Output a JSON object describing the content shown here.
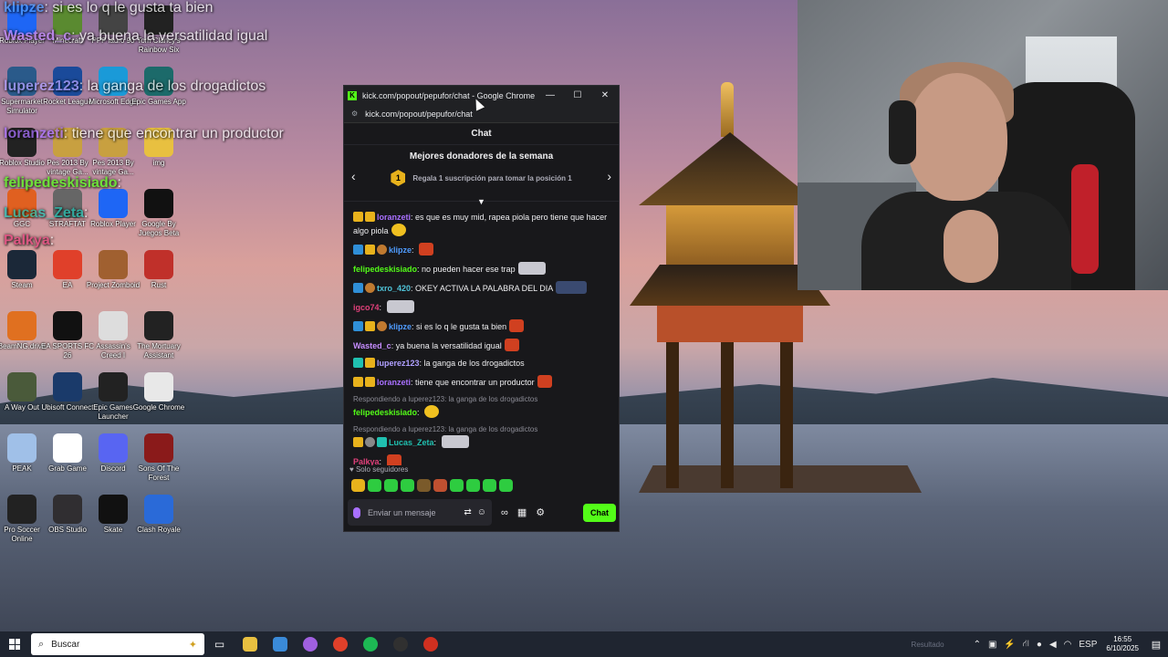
{
  "window": {
    "title": "kick.com/popout/pepufor/chat - Google Chrome",
    "url": "kick.com/popout/pepufor/chat",
    "minimize": "—",
    "maximize": "☐",
    "close": "✕"
  },
  "chat": {
    "header": "Chat",
    "donors_title": "Mejores donadores de la semana",
    "donors_badge": "1",
    "donors_text": "Regala 1 suscripción para tomar la posición 1",
    "prev": "‹",
    "next": "›",
    "messages": [
      {
        "user": "loranzeti",
        "color": "#a970ff",
        "text": "es que es muy mid, rapea piola pero tiene que hacer algo piola"
      },
      {
        "user": "klipze",
        "color": "#4f9cff",
        "text": ""
      },
      {
        "user": "felipedeskisiado",
        "color": "#53fc18",
        "text": "no pueden hacer ese trap"
      },
      {
        "user": "txro_420",
        "color": "#4fc3d8",
        "text": "OKEY ACTIVA LA PALABRA DEL DIA"
      },
      {
        "user": "igco74",
        "color": "#e0407a",
        "text": ""
      },
      {
        "user": "klipze",
        "color": "#4f9cff",
        "text": "si es lo q le gusta ta bien"
      },
      {
        "user": "Wasted_c",
        "color": "#c58cff",
        "text": "ya buena la versatilidad igual"
      },
      {
        "user": "luperez123",
        "color": "#b0a0ff",
        "text": "la ganga de los drogadictos"
      },
      {
        "user": "loranzeti",
        "color": "#a970ff",
        "text": "tiene que encontrar un productor"
      },
      {
        "reply": "Respondiendo a luperez123: la ganga de los drogadictos",
        "user": "felipedeskisiado",
        "color": "#53fc18",
        "text": ""
      },
      {
        "reply": "Respondiendo a luperez123: la ganga de los drogadictos",
        "user": "Lucas_Zeta",
        "color": "#20c0b0",
        "text": ""
      },
      {
        "user": "Palkya",
        "color": "#e0407a",
        "text": ""
      }
    ],
    "followers_only": "♥ Solo seguidores",
    "input_placeholder": "Enviar un mensaje",
    "send_label": "Chat"
  },
  "overlay_lines": [
    {
      "user": "klipze",
      "text": "si es lo q le gusta ta bien"
    },
    {
      "user": "Wasted_c",
      "text": "ya buena la versatilidad igual"
    },
    {
      "user": "luperez123",
      "text": "la ganga de los drogadictos"
    },
    {
      "user": "loranzeti",
      "text": "tiene que encontrar un productor"
    },
    {
      "user": "felipedeskisiado",
      "text": ""
    },
    {
      "user": "Lucas_Zeta",
      "text": ""
    },
    {
      "user": "Palkya",
      "text": ""
    }
  ],
  "desktop_icons": [
    {
      "label": "Roblox Player",
      "color": "#1e66f5"
    },
    {
      "label": "Minecraft",
      "color": "#5a8a30"
    },
    {
      "label": "PPP lauro 90",
      "color": "#444444"
    },
    {
      "label": "Tom Clancy's Rainbow Six",
      "color": "#222222"
    },
    {
      "label": "Supermarket Simulator",
      "color": "#2a5a8a"
    },
    {
      "label": "Rocket League",
      "color": "#1a4a9a"
    },
    {
      "label": "Microsoft Edge",
      "color": "#1a9ad8"
    },
    {
      "label": "Epic Games App",
      "color": "#1c6a6a"
    },
    {
      "label": "Roblox Studio",
      "color": "#222222"
    },
    {
      "label": "Pes 2013 By vintage Ga...",
      "color": "#c8a040"
    },
    {
      "label": "Pes 2013 By vintage Ga...",
      "color": "#c8a040"
    },
    {
      "label": "img",
      "color": "#e8c040"
    },
    {
      "label": "GGC",
      "color": "#e06020"
    },
    {
      "label": "STRAFTAT",
      "color": "#666666"
    },
    {
      "label": "Roblox Player",
      "color": "#1e66f5"
    },
    {
      "label": "Google By Juegos Beta",
      "color": "#111111"
    },
    {
      "label": "Steam",
      "color": "#1b2838"
    },
    {
      "label": "EA",
      "color": "#e0402a"
    },
    {
      "label": "Project Zomboid",
      "color": "#a06030"
    },
    {
      "label": "Rust",
      "color": "#c0302a"
    },
    {
      "label": "BeamNG.drive",
      "color": "#e07020"
    },
    {
      "label": "EA SPORTS FC 26",
      "color": "#111111"
    },
    {
      "label": "Assassin's Creed I",
      "color": "#dddddd"
    },
    {
      "label": "The Mortuary Assistant",
      "color": "#222222"
    },
    {
      "label": "A Way Out",
      "color": "#4a5a3a"
    },
    {
      "label": "Ubisoft Connect",
      "color": "#1a3a6a"
    },
    {
      "label": "Epic Games Launcher",
      "color": "#222222"
    },
    {
      "label": "Google Chrome",
      "color": "#e8e8e8"
    },
    {
      "label": "PEAK",
      "color": "#a0c0e8"
    },
    {
      "label": "Grab Game",
      "color": "#ffffff"
    },
    {
      "label": "Discord",
      "color": "#5865f2"
    },
    {
      "label": "Sons Of The Forest",
      "color": "#8a1a1a"
    },
    {
      "label": "Pro Soccer Online",
      "color": "#222222"
    },
    {
      "label": "OBS Studio",
      "color": "#302e31"
    },
    {
      "label": "Skate",
      "color": "#111111"
    },
    {
      "label": "Clash Royale",
      "color": "#2a6ad8"
    }
  ],
  "taskbar": {
    "search_placeholder": "Buscar",
    "ghost_text": "Resultado",
    "language": "ESP",
    "time": "16:55",
    "date": "6/10/2025"
  },
  "colors": {
    "kick_green": "#53fc18",
    "chat_bg": "#18181b",
    "taskbar_bg": "#1f2530"
  }
}
